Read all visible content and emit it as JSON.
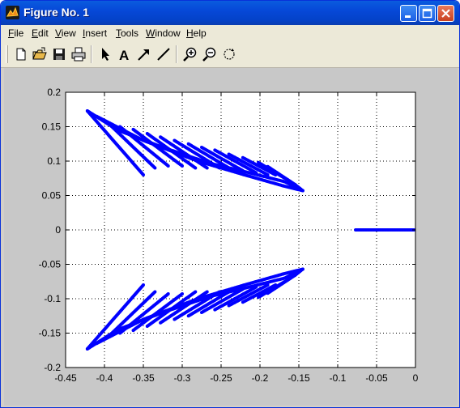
{
  "window": {
    "title": "Figure No. 1"
  },
  "menu": {
    "items": [
      {
        "label": "File",
        "accel": "F"
      },
      {
        "label": "Edit",
        "accel": "E"
      },
      {
        "label": "View",
        "accel": "V"
      },
      {
        "label": "Insert",
        "accel": "I"
      },
      {
        "label": "Tools",
        "accel": "T"
      },
      {
        "label": "Window",
        "accel": "W"
      },
      {
        "label": "Help",
        "accel": "H"
      }
    ]
  },
  "toolbar": {
    "buttons": [
      "new-figure-icon",
      "open-file-icon",
      "save-icon",
      "print-icon",
      "edit-plot-arrow-icon",
      "insert-text-icon",
      "insert-arrow-icon",
      "insert-line-icon",
      "zoom-in-icon",
      "zoom-out-icon",
      "rotate-3d-icon"
    ]
  },
  "colors": {
    "series": "#0000ff",
    "figure_bg": "#c8c8c8",
    "axes_bg": "#ffffff"
  },
  "chart_data": {
    "type": "scatter",
    "title": "",
    "xlabel": "",
    "ylabel": "",
    "xlim": [
      -0.45,
      0
    ],
    "ylim": [
      -0.2,
      0.2
    ],
    "xticks": [
      "-0.45",
      "-0.4",
      "-0.35",
      "-0.3",
      "-0.25",
      "-0.2",
      "-0.15",
      "-0.1",
      "-0.05",
      "0"
    ],
    "yticks": [
      "0.2",
      "0.15",
      "0.1",
      "0.05",
      "0",
      "-0.05",
      "-0.1",
      "-0.15",
      "-0.2"
    ],
    "grid": true,
    "grid_style": "dotted",
    "marker": "point",
    "color": "#0000ff",
    "series": [
      {
        "values": [
          [
            [
              -0.422,
              0.173
            ],
            [
              -0.35,
              0.08
            ]
          ],
          [
            [
              -0.422,
              0.173
            ],
            [
              -0.383,
              0.145
            ],
            [
              -0.325,
              0.12
            ],
            [
              -0.265,
              0.097
            ],
            [
              -0.21,
              0.082
            ],
            [
              -0.168,
              0.07
            ],
            [
              -0.145,
              0.057
            ]
          ],
          [
            [
              -0.41,
              0.165
            ],
            [
              -0.35,
              0.13
            ],
            [
              -0.28,
              0.1
            ],
            [
              -0.22,
              0.08
            ],
            [
              -0.17,
              0.064
            ],
            [
              -0.145,
              0.057
            ]
          ],
          [
            [
              -0.395,
              0.155
            ],
            [
              -0.335,
              0.09
            ]
          ],
          [
            [
              -0.38,
              0.15
            ],
            [
              -0.318,
              0.093
            ]
          ],
          [
            [
              -0.363,
              0.146
            ],
            [
              -0.3,
              0.093
            ]
          ],
          [
            [
              -0.345,
              0.14
            ],
            [
              -0.283,
              0.09
            ]
          ],
          [
            [
              -0.328,
              0.135
            ],
            [
              -0.268,
              0.09
            ]
          ],
          [
            [
              -0.31,
              0.13
            ],
            [
              -0.252,
              0.09
            ]
          ],
          [
            [
              -0.292,
              0.125
            ],
            [
              -0.237,
              0.088
            ]
          ],
          [
            [
              -0.275,
              0.12
            ],
            [
              -0.222,
              0.086
            ]
          ],
          [
            [
              -0.258,
              0.116
            ],
            [
              -0.205,
              0.083
            ]
          ],
          [
            [
              -0.24,
              0.11
            ],
            [
              -0.19,
              0.08
            ]
          ],
          [
            [
              -0.222,
              0.105
            ],
            [
              -0.18,
              0.08
            ]
          ],
          [
            [
              -0.202,
              0.098
            ],
            [
              -0.168,
              0.075
            ]
          ],
          [
            [
              -0.19,
              0.092
            ],
            [
              -0.155,
              0.066
            ],
            [
              -0.145,
              0.057
            ]
          ]
        ]
      },
      {
        "values": [
          [
            [
              -0.422,
              -0.173
            ],
            [
              -0.35,
              -0.08
            ]
          ],
          [
            [
              -0.422,
              -0.173
            ],
            [
              -0.383,
              -0.145
            ],
            [
              -0.325,
              -0.12
            ],
            [
              -0.265,
              -0.097
            ],
            [
              -0.21,
              -0.082
            ],
            [
              -0.168,
              -0.07
            ],
            [
              -0.145,
              -0.057
            ]
          ],
          [
            [
              -0.41,
              -0.165
            ],
            [
              -0.35,
              -0.13
            ],
            [
              -0.28,
              -0.1
            ],
            [
              -0.22,
              -0.08
            ],
            [
              -0.17,
              -0.064
            ],
            [
              -0.145,
              -0.057
            ]
          ],
          [
            [
              -0.395,
              -0.155
            ],
            [
              -0.335,
              -0.09
            ]
          ],
          [
            [
              -0.38,
              -0.15
            ],
            [
              -0.318,
              -0.093
            ]
          ],
          [
            [
              -0.363,
              -0.146
            ],
            [
              -0.3,
              -0.093
            ]
          ],
          [
            [
              -0.345,
              -0.14
            ],
            [
              -0.283,
              -0.09
            ]
          ],
          [
            [
              -0.328,
              -0.135
            ],
            [
              -0.268,
              -0.09
            ]
          ],
          [
            [
              -0.31,
              -0.13
            ],
            [
              -0.252,
              -0.09
            ]
          ],
          [
            [
              -0.292,
              -0.125
            ],
            [
              -0.237,
              -0.088
            ]
          ],
          [
            [
              -0.275,
              -0.12
            ],
            [
              -0.222,
              -0.086
            ]
          ],
          [
            [
              -0.258,
              -0.116
            ],
            [
              -0.205,
              -0.083
            ]
          ],
          [
            [
              -0.24,
              -0.11
            ],
            [
              -0.19,
              -0.08
            ]
          ],
          [
            [
              -0.222,
              -0.105
            ],
            [
              -0.18,
              -0.08
            ]
          ],
          [
            [
              -0.202,
              -0.098
            ],
            [
              -0.168,
              -0.075
            ]
          ],
          [
            [
              -0.19,
              -0.092
            ],
            [
              -0.155,
              -0.066
            ],
            [
              -0.145,
              -0.057
            ]
          ]
        ]
      },
      {
        "values": [
          [
            [
              -0.077,
              0
            ],
            [
              -0.002,
              0
            ]
          ]
        ]
      }
    ]
  }
}
